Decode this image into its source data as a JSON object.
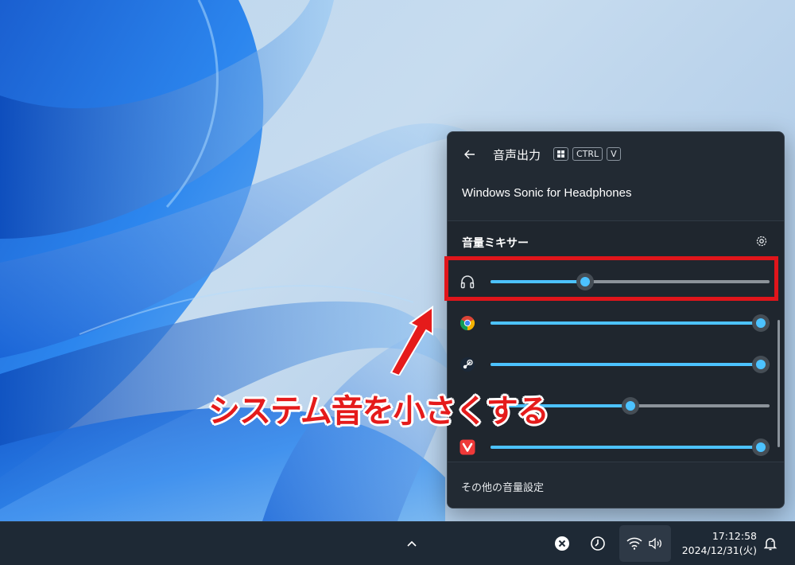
{
  "panel": {
    "title": "音声出力",
    "shortcut_keys": [
      "CTRL",
      "V"
    ],
    "device_name": "Windows Sonic for Headphones",
    "mixer_title": "音量ミキサー",
    "more_settings": "その他の音量設定",
    "sliders": [
      {
        "app": "system-sounds",
        "icon": "headphones-icon",
        "level": 0.34
      },
      {
        "app": "chrome",
        "icon": "chrome-icon",
        "level": 0.97
      },
      {
        "app": "steam",
        "icon": "steam-icon",
        "level": 0.97
      },
      {
        "app": "unknown",
        "icon": "",
        "level": 0.5
      },
      {
        "app": "vivaldi",
        "icon": "vivaldi-icon",
        "level": 0.97
      }
    ]
  },
  "annotation": {
    "text": "システム音を小さくする",
    "color": "#e51b1b"
  },
  "taskbar": {
    "time": "17:12:58",
    "date": "2024/12/31(火)"
  },
  "colors": {
    "accent": "#4cc2ff",
    "panel_bg": "#222a33",
    "highlight": "#e0151b"
  }
}
